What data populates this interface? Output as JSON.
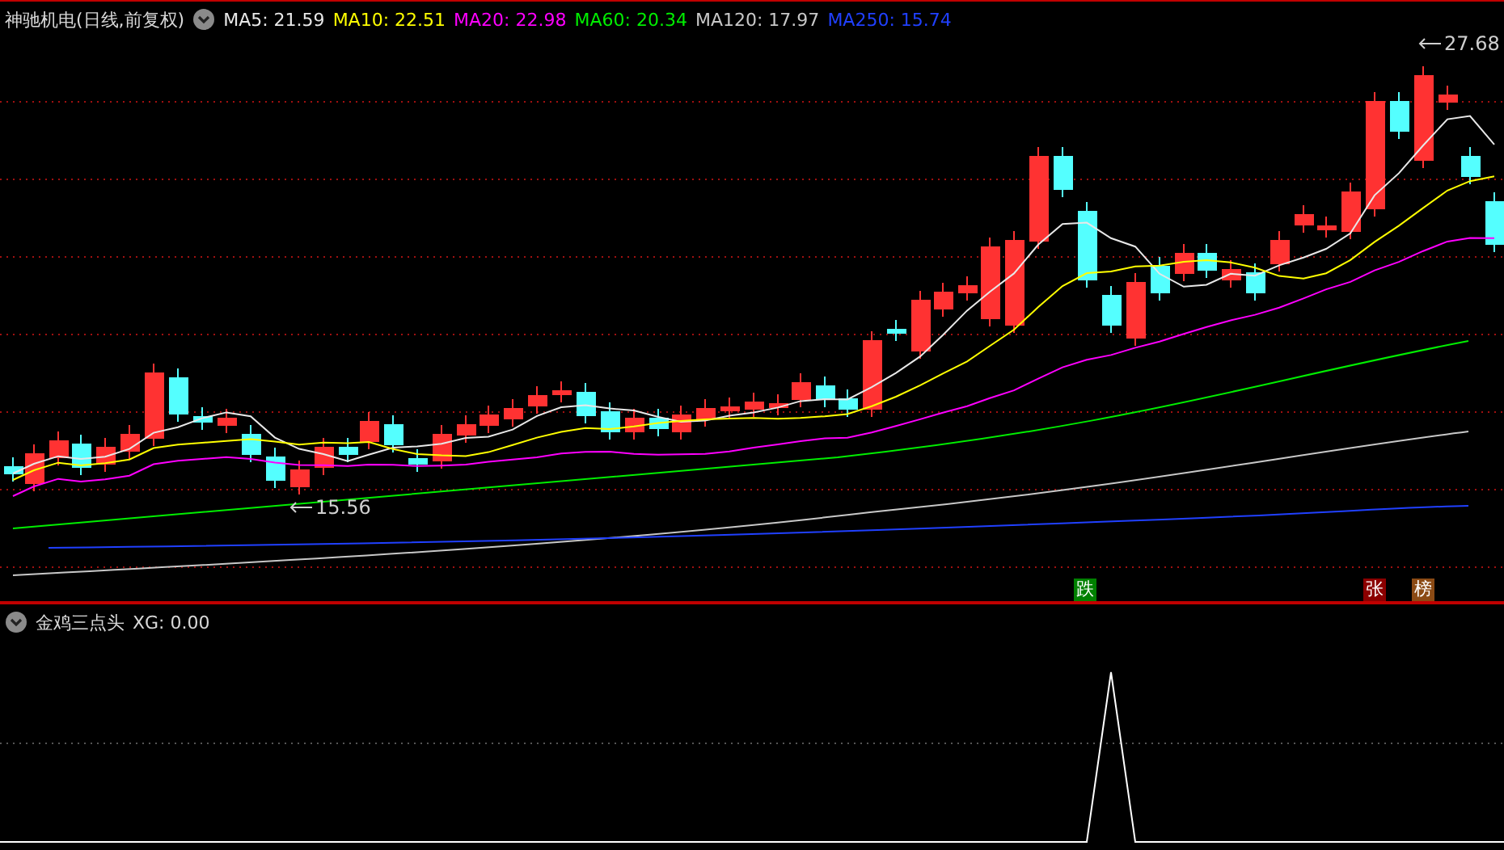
{
  "stock_panel": {
    "title": "神驰机电(日线,前复权)",
    "moving_averages": [
      {
        "label": "MA5: 21.59",
        "color": "#e8e8e8"
      },
      {
        "label": "MA10: 22.51",
        "color": "#ffff00"
      },
      {
        "label": "MA20: 22.98",
        "color": "#ff00ff"
      },
      {
        "label": "MA60: 20.34",
        "color": "#00ee00"
      },
      {
        "label": "MA120: 17.97",
        "color": "#c8c8c8"
      },
      {
        "label": "MA250: 15.74",
        "color": "#2040ff"
      }
    ],
    "price_labels": [
      {
        "text": "27.68"
      },
      {
        "text": "15.56"
      }
    ],
    "signal_badges": [
      {
        "text": "跌",
        "color": "#008000"
      },
      {
        "text": "张",
        "color": "#8b0000"
      },
      {
        "text": "榜",
        "color": "#8b4a14"
      }
    ]
  },
  "indicator_panel": {
    "title": "金鸡三点头",
    "reading": "XG: 0.00"
  }
}
